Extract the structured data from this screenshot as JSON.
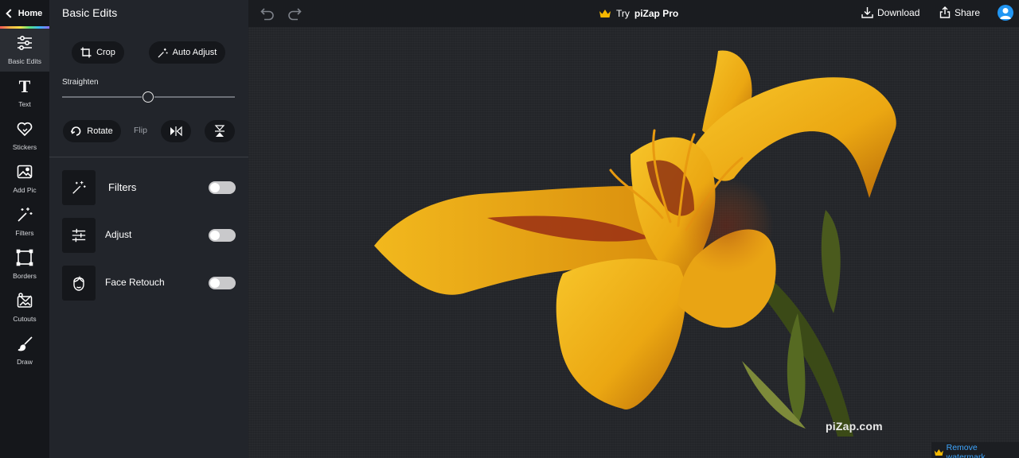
{
  "nav": {
    "home_label": "Home",
    "tools": [
      {
        "label": "Basic Edits",
        "icon": "sliders-icon"
      },
      {
        "label": "Text",
        "icon": "text-icon"
      },
      {
        "label": "Stickers",
        "icon": "sticker-heart-icon"
      },
      {
        "label": "Add Pic",
        "icon": "add-picture-icon"
      },
      {
        "label": "Filters",
        "icon": "magic-wand-icon"
      },
      {
        "label": "Borders",
        "icon": "border-frame-icon"
      },
      {
        "label": "Cutouts",
        "icon": "cutout-icon"
      },
      {
        "label": "Draw",
        "icon": "brush-icon"
      }
    ]
  },
  "panel": {
    "title": "Basic Edits",
    "crop_label": "Crop",
    "auto_adjust_label": "Auto Adjust",
    "straighten_label": "Straighten",
    "straighten_value": 0.5,
    "rotate_label": "Rotate",
    "flip_label": "Flip",
    "features": [
      {
        "label": "Filters",
        "enabled": false
      },
      {
        "label": "Adjust",
        "enabled": false
      },
      {
        "label": "Face Retouch",
        "enabled": false
      }
    ]
  },
  "topbar": {
    "try_prefix": "Try",
    "brand_pro": "piZap Pro",
    "download_label": "Download",
    "share_label": "Share"
  },
  "canvas": {
    "watermark_text": "piZap.com",
    "remove_watermark_label": "Remove watermark"
  },
  "colors": {
    "rail_bg": "#15171b",
    "panel_bg": "#22252b",
    "canvas_bg": "#25272b",
    "link_blue": "#3ea6ff",
    "crown_gold": "#f5b800"
  }
}
